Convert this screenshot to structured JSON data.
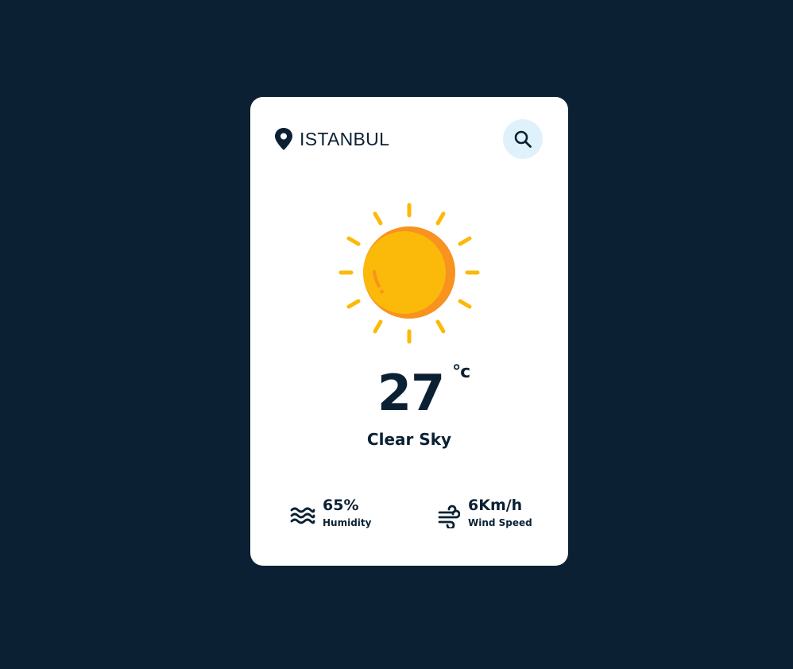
{
  "header": {
    "location_icon": "map-pin-icon",
    "city_value": "ISTANBUL",
    "search_icon": "search-icon"
  },
  "weather": {
    "icon": "sun-icon",
    "temperature": "27",
    "unit": "°c",
    "condition": "Clear Sky"
  },
  "stats": {
    "humidity": {
      "icon": "waves-icon",
      "value": "65%",
      "label": "Humidity"
    },
    "wind": {
      "icon": "wind-icon",
      "value": "6Km/h",
      "label": "Wind Speed"
    }
  },
  "colors": {
    "background": "#0b2133",
    "card": "#ffffff",
    "text": "#0b2133",
    "search_bg": "#dff2fc",
    "sun": "#fbb909",
    "sun_shadow": "#f7931e"
  }
}
